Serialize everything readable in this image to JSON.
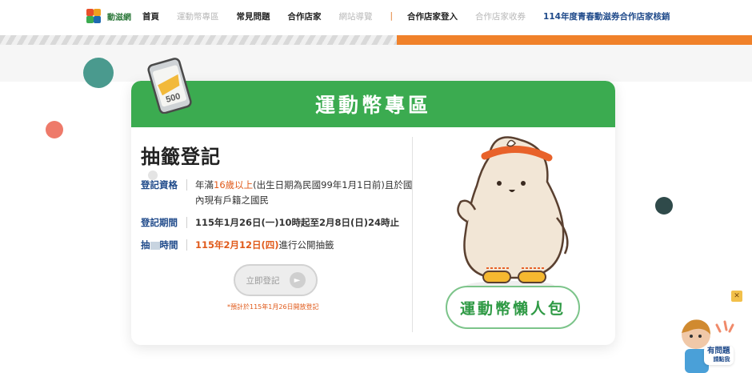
{
  "site": {
    "logo_text": "動滋網"
  },
  "nav": {
    "items": [
      {
        "label": "首頁",
        "style": "dark"
      },
      {
        "label": "運動幣專區",
        "style": "muted"
      },
      {
        "label": "常見問題",
        "style": "dark"
      },
      {
        "label": "合作店家",
        "style": "dark"
      },
      {
        "label": "網站導覽",
        "style": "muted"
      },
      {
        "label": "|",
        "style": "sep"
      },
      {
        "label": "合作店家登入",
        "style": "dark"
      },
      {
        "label": "合作店家收券",
        "style": "muted"
      },
      {
        "label": "114年度青春動滋券合作店家核銷",
        "style": "blue"
      }
    ]
  },
  "card": {
    "title": "運動幣專區",
    "ticket_value": "500",
    "section_title": "抽籤登記",
    "eligibility": {
      "label": "登記資格",
      "pre": "年滿",
      "age": "16歲以上",
      "post": "(出生日期為民國99年1月1日前)且於國內現有戶籍之國民"
    },
    "period": {
      "label": "登記期間",
      "value": "115年1月26日(一)10時起至2月8日(日)24時止"
    },
    "draw": {
      "label_a": "抽",
      "label_b": "時間",
      "date": "115年2月12日(四)",
      "suffix": "進行公開抽籤"
    },
    "register_button": "立即登記",
    "register_note": "*預計於115年1月26日開放登記",
    "lazy_button": "運動幣懶人包"
  },
  "help": {
    "line1": "有問題",
    "line2": "請點我"
  },
  "colors": {
    "green": "#3bab50",
    "orange": "#f0812a",
    "navy": "#1f4a8a",
    "accent": "#e05a1a"
  }
}
